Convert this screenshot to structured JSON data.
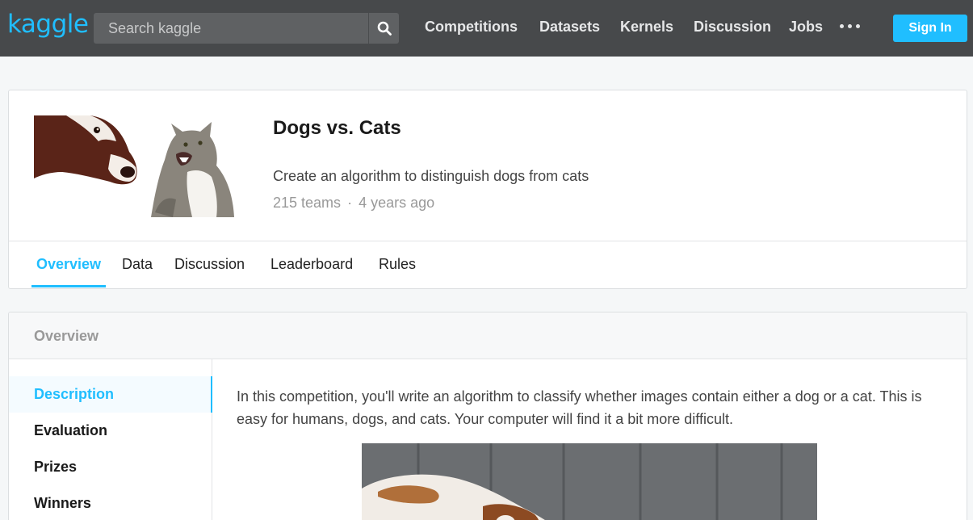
{
  "brand": {
    "logo_text": "kaggle",
    "accent": "#20beff",
    "nav_bg": "#47494b"
  },
  "search": {
    "placeholder": "Search kaggle",
    "icon": "search-icon"
  },
  "nav": {
    "links": [
      "Competitions",
      "Datasets",
      "Kernels",
      "Discussion",
      "Jobs"
    ],
    "more_icon": "ellipsis-icon",
    "sign_in": "Sign In"
  },
  "competition": {
    "title": "Dogs vs. Cats",
    "subtitle": "Create an algorithm to distinguish dogs from cats",
    "teams": "215 teams",
    "separator": "·",
    "age": "4 years ago"
  },
  "tabs": {
    "items": [
      "Overview",
      "Data",
      "Discussion",
      "Leaderboard",
      "Rules"
    ],
    "active": "Overview"
  },
  "overview": {
    "header": "Overview",
    "sidebar": [
      "Description",
      "Evaluation",
      "Prizes",
      "Winners"
    ],
    "active": "Description",
    "description": "In this competition, you'll write an algorithm to classify whether images contain either a dog or a cat.  This is easy for humans, dogs, and cats. Your computer will find it a bit more difficult."
  }
}
